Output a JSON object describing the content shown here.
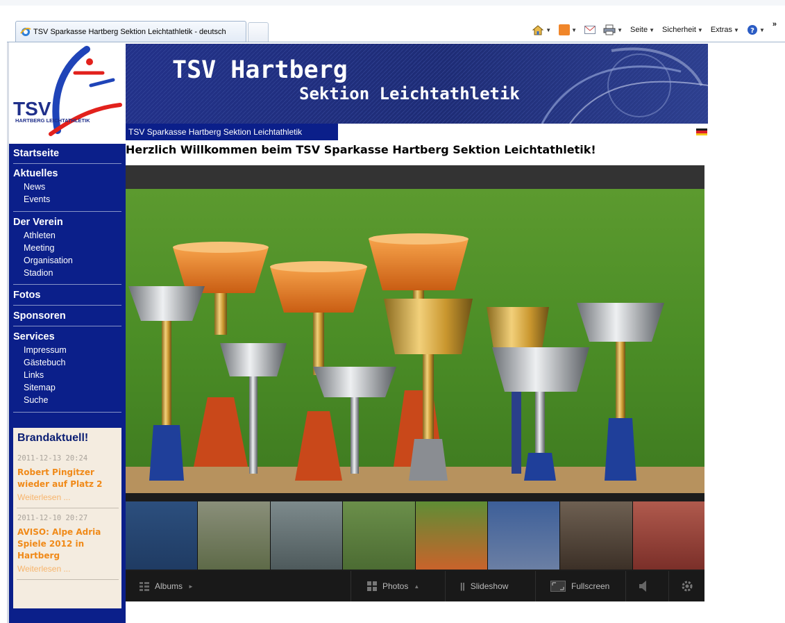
{
  "browser": {
    "tab_title": "TSV Sparkasse Hartberg Sektion Leichtathletik - deutsch",
    "toolbar": {
      "page_label": "Seite",
      "safety_label": "Sicherheit",
      "extras_label": "Extras",
      "overflow_label": "»"
    }
  },
  "logo": {
    "text": "TSV",
    "subtext": "HARTBERG LEICHTATHLETIK"
  },
  "banner": {
    "title": "TSV Hartberg",
    "subtitle": "Sektion Leichtathletik"
  },
  "breadcrumb": "TSV Sparkasse Hartberg Sektion Leichtathletik",
  "welcome": "Herzlich Willkommen beim TSV Sparkasse Hartberg Sektion Leichtathletik!",
  "nav": {
    "home": "Startseite",
    "current": {
      "title": "Aktuelles",
      "items": [
        "News",
        "Events"
      ]
    },
    "club": {
      "title": "Der Verein",
      "items": [
        "Athleten",
        "Meeting",
        "Organisation",
        "Stadion"
      ]
    },
    "photos": "Fotos",
    "sponsors": "Sponsoren",
    "services": {
      "title": "Services",
      "items": [
        "Impressum",
        "Gästebuch",
        "Links",
        "Sitemap",
        "Suche"
      ]
    }
  },
  "news": {
    "heading": "Brandaktuell!",
    "items": [
      {
        "date": "2011-12-13 20:24",
        "title": "Robert Pingitzer wieder auf Platz 2",
        "more": "Weiterlesen ..."
      },
      {
        "date": "2011-12-10 20:27",
        "title": "AVISO: Alpe Adria Spiele 2012 in Hartberg",
        "more": "Weiterlesen ..."
      }
    ]
  },
  "gallery": {
    "albums_label": "Albums",
    "photos_label": "Photos",
    "slideshow_label": "Slideshow",
    "fullscreen_label": "Fullscreen"
  },
  "colors": {
    "nav_bg": "#0b1f8a",
    "banner_bg": "#1c2c79",
    "news_accent": "#f08a19"
  }
}
